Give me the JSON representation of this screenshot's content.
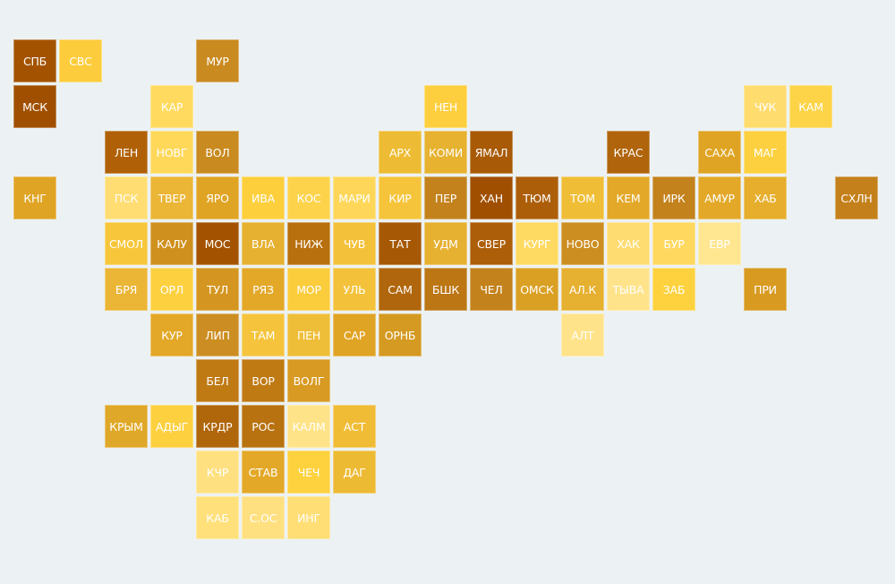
{
  "map": {
    "tiles": [
      {
        "label": "СПБ",
        "color": "#a35300"
      },
      {
        "label": "СВС",
        "color": "#fccc3c"
      },
      {
        "label": "МУР",
        "color": "#c98a20"
      },
      {
        "label": "МСК",
        "color": "#a04f00"
      },
      {
        "label": "КАР",
        "color": "#ffda5e"
      },
      {
        "label": "НЕН",
        "color": "#fdcf3e"
      },
      {
        "label": "ЧУК",
        "color": "#ffdc6e"
      },
      {
        "label": "КАМ",
        "color": "#fdd448"
      },
      {
        "label": "ЛЕН",
        "color": "#b06006"
      },
      {
        "label": "НОВГ",
        "color": "#ffd85a"
      },
      {
        "label": "ВОЛ",
        "color": "#c98a20"
      },
      {
        "label": "АРХ",
        "color": "#eebc34"
      },
      {
        "label": "КОМИ",
        "color": "#e6b230"
      },
      {
        "label": "ЯМАЛ",
        "color": "#a85a06"
      },
      {
        "label": "КРАС",
        "color": "#b0640c"
      },
      {
        "label": "САХА",
        "color": "#e0a424"
      },
      {
        "label": "МАГ",
        "color": "#fdd040"
      },
      {
        "label": "КНГ",
        "color": "#e0a424"
      },
      {
        "label": "ПСК",
        "color": "#ffdd72"
      },
      {
        "label": "ТВЕР",
        "color": "#ebb535"
      },
      {
        "label": "ЯРО",
        "color": "#e0a424"
      },
      {
        "label": "ИВА",
        "color": "#fdcf3c"
      },
      {
        "label": "КОС",
        "color": "#fdd34c"
      },
      {
        "label": "МАРИ",
        "color": "#fed75a"
      },
      {
        "label": "КИР",
        "color": "#f5c43a"
      },
      {
        "label": "ПЕР",
        "color": "#c4821c"
      },
      {
        "label": "ХАН",
        "color": "#a04f00"
      },
      {
        "label": "ТЮМ",
        "color": "#ac5e08"
      },
      {
        "label": "ТОМ",
        "color": "#f0be36"
      },
      {
        "label": "КЕМ",
        "color": "#e3a828"
      },
      {
        "label": "ИРК",
        "color": "#c4821c"
      },
      {
        "label": "АМУР",
        "color": "#e3a828"
      },
      {
        "label": "ХАБ",
        "color": "#e6ae2c"
      },
      {
        "label": "СХЛН",
        "color": "#c4801a"
      },
      {
        "label": "СМОЛ",
        "color": "#f7c63a"
      },
      {
        "label": "КАЛУ",
        "color": "#d0901e"
      },
      {
        "label": "МОС",
        "color": "#a35300"
      },
      {
        "label": "ВЛА",
        "color": "#e6b030"
      },
      {
        "label": "НИЖ",
        "color": "#b8700e"
      },
      {
        "label": "ЧУВ",
        "color": "#f3c23a"
      },
      {
        "label": "ТАТ",
        "color": "#a65804"
      },
      {
        "label": "УДМ",
        "color": "#e6b030"
      },
      {
        "label": "СВЕР",
        "color": "#ac5e08"
      },
      {
        "label": "КУРГ",
        "color": "#ffda62"
      },
      {
        "label": "НОВО",
        "color": "#cc8e20"
      },
      {
        "label": "ХАК",
        "color": "#ffdc72"
      },
      {
        "label": "БУР",
        "color": "#ffd860"
      },
      {
        "label": "ЕВР",
        "color": "#ffe690"
      },
      {
        "label": "БРЯ",
        "color": "#ebb535"
      },
      {
        "label": "ОРЛ",
        "color": "#fdd040"
      },
      {
        "label": "ТУЛ",
        "color": "#d49620"
      },
      {
        "label": "РЯЗ",
        "color": "#e3a828"
      },
      {
        "label": "МОР",
        "color": "#fbcc3c"
      },
      {
        "label": "УЛЬ",
        "color": "#f3c23a"
      },
      {
        "label": "САМ",
        "color": "#b0660c"
      },
      {
        "label": "БШК",
        "color": "#bc7614"
      },
      {
        "label": "ЧЕЛ",
        "color": "#c4821c"
      },
      {
        "label": "ОМСК",
        "color": "#daa024"
      },
      {
        "label": "АЛ.К",
        "color": "#e6b030"
      },
      {
        "label": "ТЫВА",
        "color": "#ffe38a"
      },
      {
        "label": "ЗАБ",
        "color": "#fed23e"
      },
      {
        "label": "ПРИ",
        "color": "#d89a20"
      },
      {
        "label": "КУР",
        "color": "#e3a828"
      },
      {
        "label": "ЛИП",
        "color": "#cc8e22"
      },
      {
        "label": "ТАМ",
        "color": "#f5c43c"
      },
      {
        "label": "ПЕН",
        "color": "#efbe38"
      },
      {
        "label": "САР",
        "color": "#e0a424"
      },
      {
        "label": "ОРНБ",
        "color": "#d49a22"
      },
      {
        "label": "АЛТ",
        "color": "#ffe38a"
      },
      {
        "label": "БЕЛ",
        "color": "#c07a14"
      },
      {
        "label": "ВОР",
        "color": "#c07a14"
      },
      {
        "label": "ВОЛГ",
        "color": "#d89a22"
      },
      {
        "label": "КРЫМ",
        "color": "#e0a828"
      },
      {
        "label": "АДЫГ",
        "color": "#fdd040"
      },
      {
        "label": "КРДР",
        "color": "#b0660a"
      },
      {
        "label": "РОС",
        "color": "#b87210"
      },
      {
        "label": "КАЛМ",
        "color": "#ffe388"
      },
      {
        "label": "АСТ",
        "color": "#f0bc36"
      },
      {
        "label": "КЧР",
        "color": "#ffe080"
      },
      {
        "label": "СТАВ",
        "color": "#e3a828"
      },
      {
        "label": "ЧЕЧ",
        "color": "#fed23e"
      },
      {
        "label": "ДАГ",
        "color": "#edba34"
      },
      {
        "label": "КАБ",
        "color": "#ffe07a"
      },
      {
        "label": "С.ОС",
        "color": "#ffe080"
      },
      {
        "label": "ИНГ",
        "color": "#ffde76"
      }
    ]
  }
}
